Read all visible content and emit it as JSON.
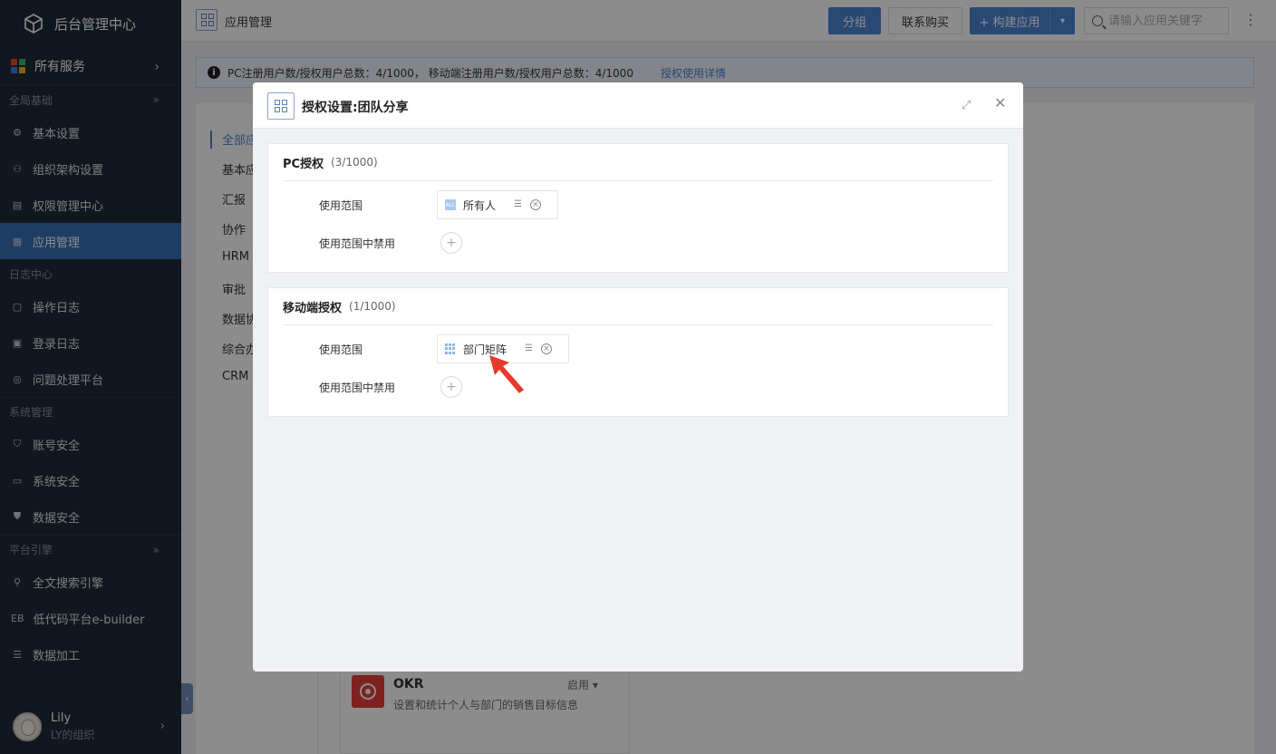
{
  "sidebar": {
    "title": "后台管理中心",
    "all_services": "所有服务",
    "sections": [
      {
        "label": "全局基础",
        "items": [
          "基本设置",
          "组织架构设置",
          "权限管理中心",
          "应用管理"
        ]
      },
      {
        "label": "日志中心",
        "items": [
          "操作日志",
          "登录日志",
          "问题处理平台"
        ]
      },
      {
        "label": "系统管理",
        "items": [
          "账号安全",
          "系统安全",
          "数据安全"
        ]
      },
      {
        "label": "平台引擎",
        "items": [
          "全文搜索引擎",
          "低代码平台e-builder",
          "数据加工"
        ]
      }
    ],
    "eb_prefix": "EB",
    "user": {
      "name": "Lily",
      "org": "LY的组织"
    }
  },
  "topbar": {
    "title": "应用管理",
    "group_btn": "分组",
    "contact_btn": "联系购买",
    "build_btn": "+ 构建应用",
    "search_placeholder": "请输入应用关键字"
  },
  "notice": {
    "text": "PC注册用户数/授权用户总数：4/1000， 移动端注册用户数/授权用户总数：4/1000",
    "link": "授权使用详情"
  },
  "categories": [
    "全部应",
    "基本应",
    "汇报",
    "协作",
    "HRM",
    "审批",
    "数据协",
    "综合办",
    "CRM"
  ],
  "okr_card": {
    "name": "OKR",
    "status": "启用",
    "desc": "设置和统计个人与部门的销售目标信息"
  },
  "modal": {
    "title": "授权设置:团队分享",
    "pc_panel": {
      "title": "PC授权",
      "count": "(3/1000)",
      "scope_label": "使用范围",
      "scope_tag": "所有人",
      "scope_tag_icon_text": "ALL",
      "disabled_label": "使用范围中禁用"
    },
    "mobile_panel": {
      "title": "移动端授权",
      "count": "(1/1000)",
      "scope_label": "使用范围",
      "scope_tag": "部门矩阵",
      "disabled_label": "使用范围中禁用"
    }
  },
  "colors": {
    "sidebar_bg": "#1f2a38",
    "accent": "#4c84d4",
    "active_item": "#3a6fb6",
    "arrow": "#e8392b",
    "okr": "#e53d3d"
  }
}
